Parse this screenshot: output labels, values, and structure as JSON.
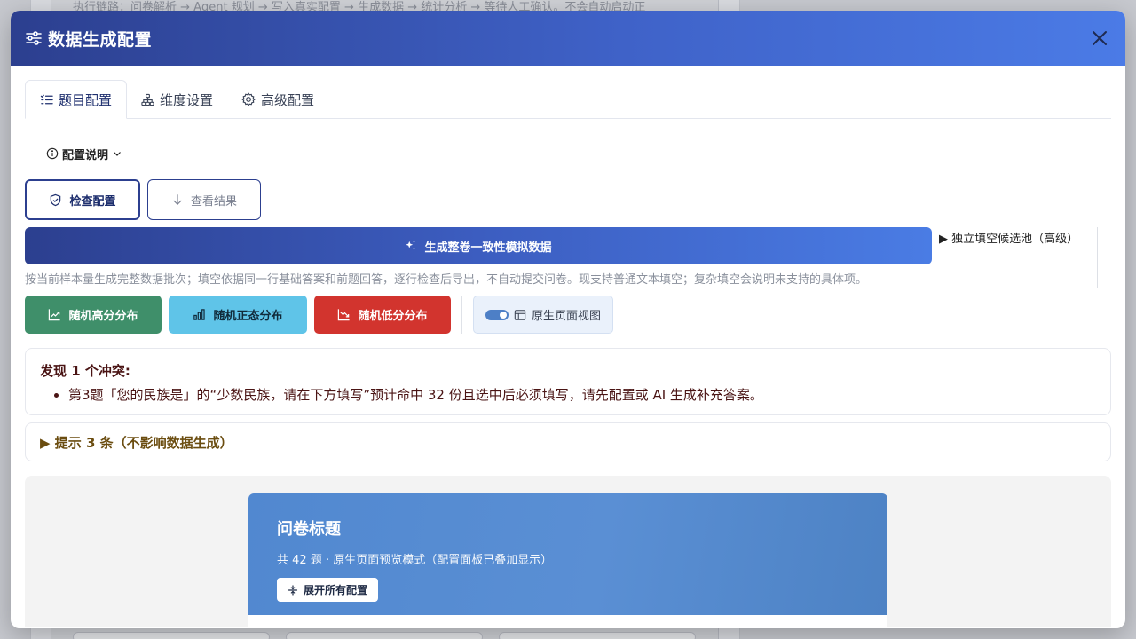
{
  "background": {
    "pipeline_text": "执行链路：问卷解析 → Agent 规划 → 写入真实配置 → 生成数据 → 统计分析 → 等待人工确认。不会自动启动正"
  },
  "modal": {
    "title": "数据生成配置",
    "header_icon": "sliders-icon",
    "close_icon": "close-icon"
  },
  "tabs": [
    {
      "label": "题目配置",
      "icon": "list-icon",
      "active": true
    },
    {
      "label": "维度设置",
      "icon": "hierarchy-icon",
      "active": false
    },
    {
      "label": "高级配置",
      "icon": "gear-icon",
      "active": false
    }
  ],
  "info": {
    "label": "配置说明",
    "icon": "info-icon"
  },
  "actions": {
    "check_label": "检查配置",
    "view_label": "查看结果"
  },
  "generate": {
    "label": "生成整卷一致性模拟数据",
    "pool_label": "▶ 独立填空候选池（高级）",
    "note": "按当前样本量生成完整数据批次；填空依据同一行基础答案和前题回答，逐行检查后导出，不自动提交问卷。现支持普通文本填空；复杂填空会说明未支持的具体项。"
  },
  "distributions": {
    "high_label": "随机高分分布",
    "normal_label": "随机正态分布",
    "low_label": "随机低分分布",
    "native_view_label": "原生页面视图",
    "colors": {
      "high": "#3f8f6a",
      "normal": "#5fc4e8",
      "low": "#d2342e"
    }
  },
  "conflicts": {
    "title_prefix": "发现",
    "count": "1",
    "title_suffix": "个冲突:",
    "items": [
      "第3题「您的民族是」的“少数民族，请在下方填写”预计命中 32 份且选中后必须填写，请先配置或 AI 生成补充答案。"
    ]
  },
  "hints": {
    "label": "▶ 提示 3 条（不影响数据生成）"
  },
  "preview": {
    "title": "问卷标题",
    "subtitle": "共 42 题 · 原生页面预览模式（配置面板已叠加显示）",
    "expand_label": "展开所有配置"
  }
}
